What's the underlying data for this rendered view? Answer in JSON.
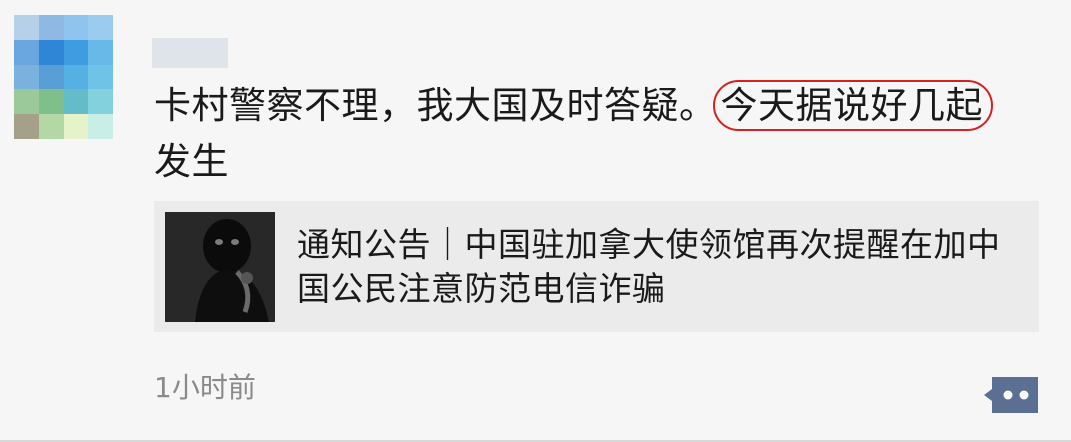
{
  "post": {
    "username": "",
    "text_main": "卡村警察不理，我大国及时答疑。",
    "text_highlight": "今天据说好几起",
    "text_tail": "发生",
    "time": "1小时前"
  },
  "link_card": {
    "title": "通知公告｜中国驻加拿大使领馆再次提醒在加中国公民注意防范电信诈骗"
  },
  "colors": {
    "highlight_circle": "#d42020",
    "comment_button": "#5b6f92",
    "card_background": "#ebebeb",
    "time_text": "#8a8a8a"
  },
  "icons": {
    "comment_button": "more-dots-icon",
    "thumbnail": "masked-caller-image"
  }
}
